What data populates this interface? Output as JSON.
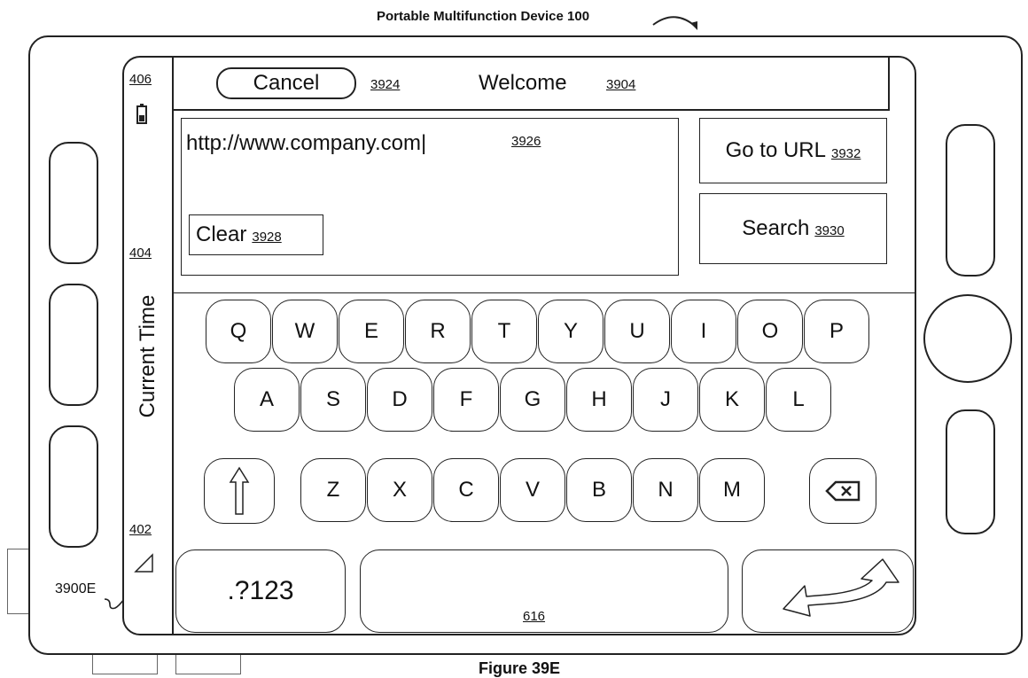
{
  "figure": {
    "device_title": "Portable Multifunction Device 100",
    "caption": "Figure 39E",
    "screen_ref": "3900E"
  },
  "status_bar": {
    "current_time": "Current Time",
    "ref_signal": "402",
    "ref_time": "404",
    "ref_battery": "406"
  },
  "header": {
    "cancel_label": "Cancel",
    "cancel_ref": "3924",
    "title": "Welcome",
    "title_ref": "3904"
  },
  "url_field": {
    "value": "http://www.company.com|",
    "ref": "3926"
  },
  "buttons": {
    "clear_label": "Clear",
    "clear_ref": "3928",
    "goto_label": "Go to URL",
    "goto_ref": "3932",
    "search_label": "Search",
    "search_ref": "3930"
  },
  "keyboard": {
    "row1": [
      "Q",
      "W",
      "E",
      "R",
      "T",
      "Y",
      "U",
      "I",
      "O",
      "P"
    ],
    "row2": [
      "A",
      "S",
      "D",
      "F",
      "G",
      "H",
      "J",
      "K",
      "L"
    ],
    "row3": [
      "Z",
      "X",
      "C",
      "V",
      "B",
      "N",
      "M"
    ],
    "numbers_label": ".?123",
    "space_ref": "616",
    "icons": {
      "shift": "shift-arrow-icon",
      "backspace": "backspace-icon",
      "return": "return-arrow-icon"
    }
  }
}
